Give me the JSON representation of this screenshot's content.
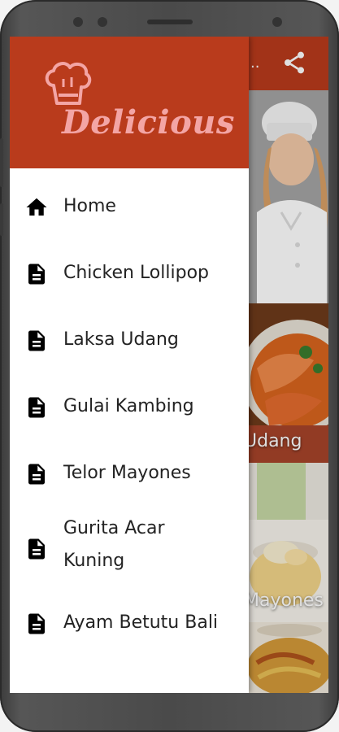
{
  "colors": {
    "primary": "#b93b1c",
    "logo_text": "#f3a5a5",
    "drawer_bg": "#ffffff",
    "text": "#232323"
  },
  "app_bar": {
    "title_truncated": "..",
    "share_icon": "share-icon"
  },
  "background_cards": [
    {
      "image": "chef-woman-illustration",
      "caption": ""
    },
    {
      "image": "laksa-udang-photo",
      "caption": "Udang"
    },
    {
      "image": "telor-mayones-photo",
      "caption": "Mayones"
    },
    {
      "image": "gurita-acar-photo",
      "caption": ""
    }
  ],
  "drawer": {
    "logo": {
      "text": "Delicious",
      "icon": "chef-hat-icon"
    },
    "items": [
      {
        "label": "Home",
        "icon": "home-icon"
      },
      {
        "label": "Chicken Lollipop",
        "icon": "document-icon"
      },
      {
        "label": "Laksa Udang",
        "icon": "document-icon"
      },
      {
        "label": "Gulai Kambing",
        "icon": "document-icon"
      },
      {
        "label": "Telor Mayones",
        "icon": "document-icon"
      },
      {
        "label": "Gurita Acar Kuning",
        "icon": "document-icon"
      },
      {
        "label": "Ayam Betutu Bali",
        "icon": "document-icon"
      }
    ]
  }
}
